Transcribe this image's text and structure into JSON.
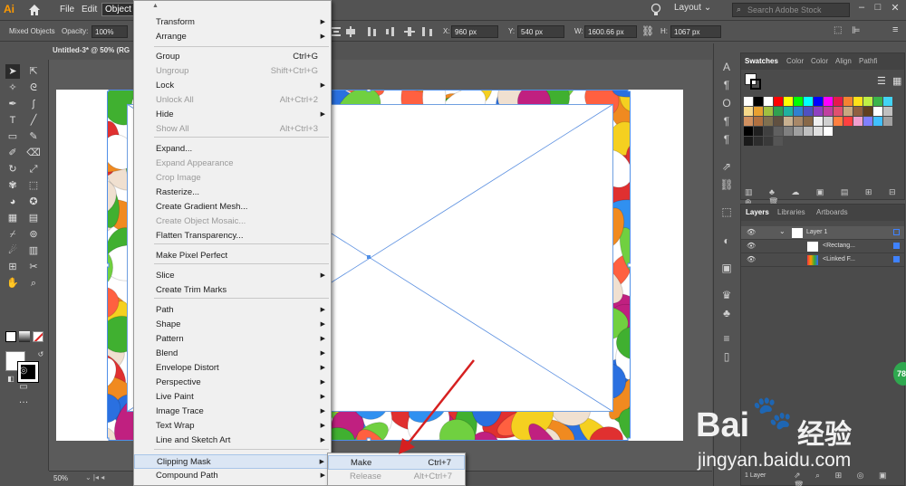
{
  "app": {
    "logo": "Ai"
  },
  "menubar": {
    "items": [
      "File",
      "Edit",
      "Object"
    ],
    "workspace": "Layout",
    "search_placeholder": "Search Adobe Stock"
  },
  "controlbar": {
    "selection": "Mixed Objects",
    "opacity_label": "Opacity:",
    "opacity_value": "100%",
    "x_label": "X:",
    "x_value": "960 px",
    "y_label": "Y:",
    "y_value": "540 px",
    "w_label": "W:",
    "w_value": "1600.66 px",
    "h_label": "H:",
    "h_value": "1067 px"
  },
  "document": {
    "tab_title": "Untitled-3* @ 50% (RG"
  },
  "status": {
    "zoom": "50%"
  },
  "panels": {
    "swatches_tabs": [
      "Swatches",
      "Color",
      "Color",
      "Align",
      "Pathfi"
    ],
    "layers_tabs": [
      "Layers",
      "Libraries",
      "Artboards"
    ],
    "layers": [
      {
        "name": "Layer 1"
      },
      {
        "name": "<Rectang..."
      },
      {
        "name": "<Linked F..."
      }
    ],
    "layers_count": "1 Layer"
  },
  "object_menu": {
    "items": [
      {
        "label": "Transform",
        "submenu": true
      },
      {
        "label": "Arrange",
        "submenu": true
      },
      {
        "label": "Group",
        "shortcut": "Ctrl+G"
      },
      {
        "label": "Ungroup",
        "shortcut": "Shift+Ctrl+G",
        "disabled": true
      },
      {
        "label": "Lock",
        "submenu": true
      },
      {
        "label": "Unlock All",
        "shortcut": "Alt+Ctrl+2",
        "disabled": true
      },
      {
        "label": "Hide",
        "submenu": true
      },
      {
        "label": "Show All",
        "shortcut": "Alt+Ctrl+3",
        "disabled": true
      },
      {
        "label": "Expand..."
      },
      {
        "label": "Expand Appearance",
        "disabled": true
      },
      {
        "label": "Crop Image",
        "disabled": true
      },
      {
        "label": "Rasterize..."
      },
      {
        "label": "Create Gradient Mesh..."
      },
      {
        "label": "Create Object Mosaic...",
        "disabled": true
      },
      {
        "label": "Flatten Transparency..."
      },
      {
        "label": "Make Pixel Perfect"
      },
      {
        "label": "Slice",
        "submenu": true
      },
      {
        "label": "Create Trim Marks"
      },
      {
        "label": "Path",
        "submenu": true
      },
      {
        "label": "Shape",
        "submenu": true
      },
      {
        "label": "Pattern",
        "submenu": true
      },
      {
        "label": "Blend",
        "submenu": true
      },
      {
        "label": "Envelope Distort",
        "submenu": true
      },
      {
        "label": "Perspective",
        "submenu": true
      },
      {
        "label": "Live Paint",
        "submenu": true
      },
      {
        "label": "Image Trace",
        "submenu": true
      },
      {
        "label": "Text Wrap",
        "submenu": true
      },
      {
        "label": "Line and Sketch Art",
        "submenu": true
      },
      {
        "label": "Clipping Mask",
        "submenu": true,
        "highlighted": true
      },
      {
        "label": "Compound Path",
        "submenu": true
      }
    ]
  },
  "clipping_submenu": {
    "items": [
      {
        "label": "Make",
        "shortcut": "Ctrl+7",
        "highlighted": true
      },
      {
        "label": "Release",
        "shortcut": "Alt+Ctrl+7",
        "disabled": true
      }
    ]
  },
  "watermark": {
    "brand": "Bai",
    "brand2": "经验",
    "url": "jingyan.baidu.com",
    "badge": "78"
  },
  "colors": {
    "accent": "#2f6fd8",
    "arrow": "#d62020",
    "menu_bg": "#f0f0f0"
  }
}
